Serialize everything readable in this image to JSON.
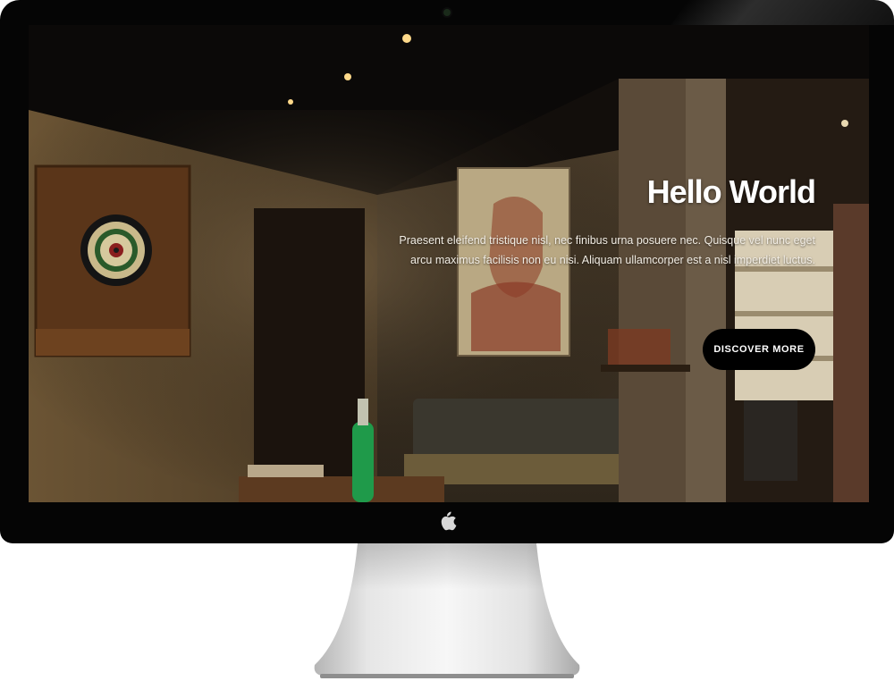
{
  "hero": {
    "title": "Hello World",
    "body": "Praesent eleifend tristique nisl, nec finibus urna posuere nec. Quisque vel nunc eget arcu maximus facilisis non eu nisi. Aliquam ullamcorper est a nisl imperdiet luctus.",
    "cta_label": "DISCOVER MORE"
  },
  "colors": {
    "bezel": "#050505",
    "cta_background": "#000000",
    "cta_text": "#ffffff",
    "title_text": "#ffffff"
  },
  "icons": {
    "brand_logo": "apple-logo-icon",
    "camera": "camera-icon"
  }
}
